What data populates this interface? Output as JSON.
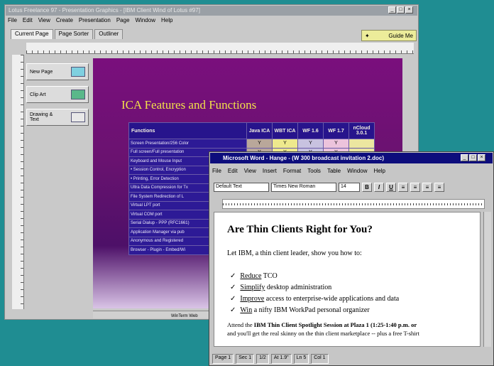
{
  "presentation": {
    "title": "Lotus Freelance 97 - Presentation Graphics - [IBM Client Wind of Lotus #97]",
    "menu": [
      "File",
      "Edit",
      "View",
      "Create",
      "Presentation",
      "Page",
      "Window",
      "Help"
    ],
    "tabs": [
      "Current Page",
      "Page Sorter",
      "Outliner"
    ],
    "guide_label": "Guide Me",
    "left_buttons": [
      {
        "label": "New Page",
        "icon": "new-page-icon"
      },
      {
        "label": "Clip Art",
        "icon": "clip-art-icon"
      },
      {
        "label": "Drawing & Text",
        "icon": "drawing-text-icon"
      }
    ],
    "hscroll_text": "WinTerm Web",
    "slide": {
      "title": "ICA Features and Functions",
      "headers": [
        "Functions",
        "Java ICA",
        "WBT ICA",
        "WF 1.6",
        "WF 1.7",
        "nCloud 3.0.1"
      ],
      "rows": [
        {
          "f": "Screen Presentation/256 Color",
          "v": [
            "Y",
            "Y",
            "Y",
            "Y"
          ]
        },
        {
          "f": "Full screen/Full presentation",
          "v": [
            "Y",
            "Y",
            "Y",
            "Y"
          ]
        },
        {
          "f": "Keyboard and Mouse Input",
          "v": [
            "Y",
            "Y",
            "Y",
            "Y"
          ]
        },
        {
          "f": "• Session Control, Encryption",
          "v": [
            "Y",
            "Y",
            "Y",
            "Y"
          ]
        },
        {
          "f": "• Printing, Error Detection",
          "v": [
            "",
            "",
            "",
            ""
          ]
        },
        {
          "f": "Ultra Data Compression for Tx",
          "v": [
            "",
            "",
            "",
            ""
          ]
        },
        {
          "f": "File System Redirection of L",
          "v": [
            "",
            "",
            "",
            ""
          ]
        },
        {
          "f": "Virtual LPT port",
          "v": [
            "",
            "",
            "",
            ""
          ]
        },
        {
          "f": "Virtual COM port",
          "v": [
            "",
            "",
            "",
            ""
          ]
        },
        {
          "f": "Serial Dialup - PPP (RFC1661)",
          "v": [
            "",
            "",
            "",
            ""
          ]
        },
        {
          "f": "Application Manager via pub",
          "v": [
            "",
            "",
            "",
            ""
          ]
        },
        {
          "f": "Anonymous and Registered",
          "v": [
            "",
            "",
            "",
            ""
          ]
        },
        {
          "f": "Browser - Plugin - Embed/Wi",
          "v": [
            "",
            "",
            "",
            ""
          ]
        }
      ]
    }
  },
  "word": {
    "title": "Microsoft Word - Hange - (W 300 broadcast invitation 2.doc)",
    "menu": [
      "File",
      "Edit",
      "View",
      "Insert",
      "Format",
      "Tools",
      "Table",
      "Window",
      "Help"
    ],
    "style": "Default Text",
    "font": "Times New Roman",
    "size": "14",
    "bold": "B",
    "italic": "I",
    "underline": "U",
    "doc": {
      "heading": "Are Thin Clients Right for You?",
      "intro": "Let IBM, a thin client leader, show you how to:",
      "bullets": [
        {
          "k": "Reduce",
          "rest": " TCO"
        },
        {
          "k": "Simplify",
          "rest": " desktop administration"
        },
        {
          "k": "Improve",
          "rest": " access to enterprise-wide applications and data"
        },
        {
          "k": "Win",
          "rest": " a nifty IBM WorkPad personal organizer"
        }
      ],
      "foot_pre": "Attend the ",
      "foot_bold": "IBM Thin Client Spotlight Session at Plaza 1 (1:25-1:40 p.m. or",
      "foot_line2": "and you'll get the real skinny on the thin client marketplace -- plus a free T-shirt"
    },
    "status": [
      "Page 1",
      "Sec 1",
      "1/2",
      "At 1.9\"",
      "Ln 5",
      "Col 1"
    ]
  }
}
